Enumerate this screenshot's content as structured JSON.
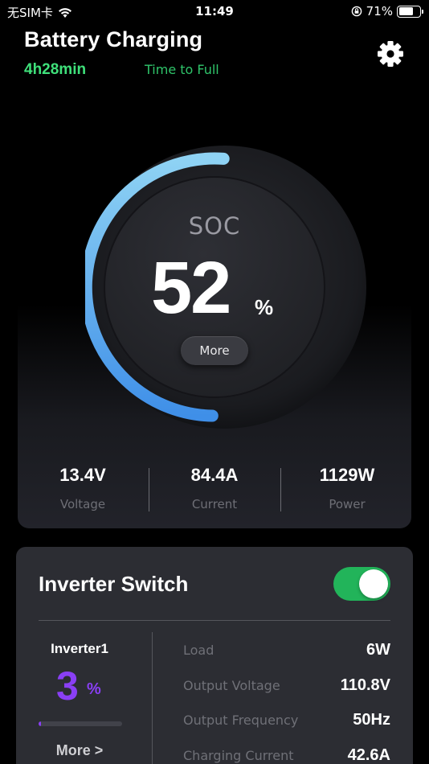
{
  "status_bar": {
    "carrier": "无SIM卡",
    "time": "11:49",
    "battery_percent": "71%",
    "battery_level": 0.71,
    "icons": [
      "wifi-icon",
      "orientation-lock-icon",
      "battery-icon"
    ]
  },
  "header": {
    "title": "Battery Charging",
    "time_value": "4h28min",
    "time_label": "Time to Full",
    "settings_icon": "gear-icon"
  },
  "soc": {
    "label": "SOC",
    "value": "52",
    "unit": "%",
    "level": 0.52,
    "more_label": "More"
  },
  "metrics": [
    {
      "value": "13.4V",
      "label": "Voltage"
    },
    {
      "value": "84.4A",
      "label": "Current"
    },
    {
      "value": "1129W",
      "label": "Power"
    }
  ],
  "inverter": {
    "title": "Inverter Switch",
    "switch_on": true,
    "name": "Inverter1",
    "percent": "3",
    "unit": "%",
    "level": 0.03,
    "more_label": "More >",
    "rows": [
      {
        "label": "Load",
        "value": "6W"
      },
      {
        "label": "Output Voltage",
        "value": "110.8V"
      },
      {
        "label": "Output Frequency",
        "value": "50Hz"
      },
      {
        "label": "Charging Current",
        "value": "42.6A"
      }
    ]
  },
  "colors": {
    "accent_green": "#3fe07a",
    "arc_start": "#8fd3f4",
    "arc_end": "#3f8fe8",
    "inverter_purple": "#8a3ff5",
    "toggle_on": "#22b45a"
  }
}
